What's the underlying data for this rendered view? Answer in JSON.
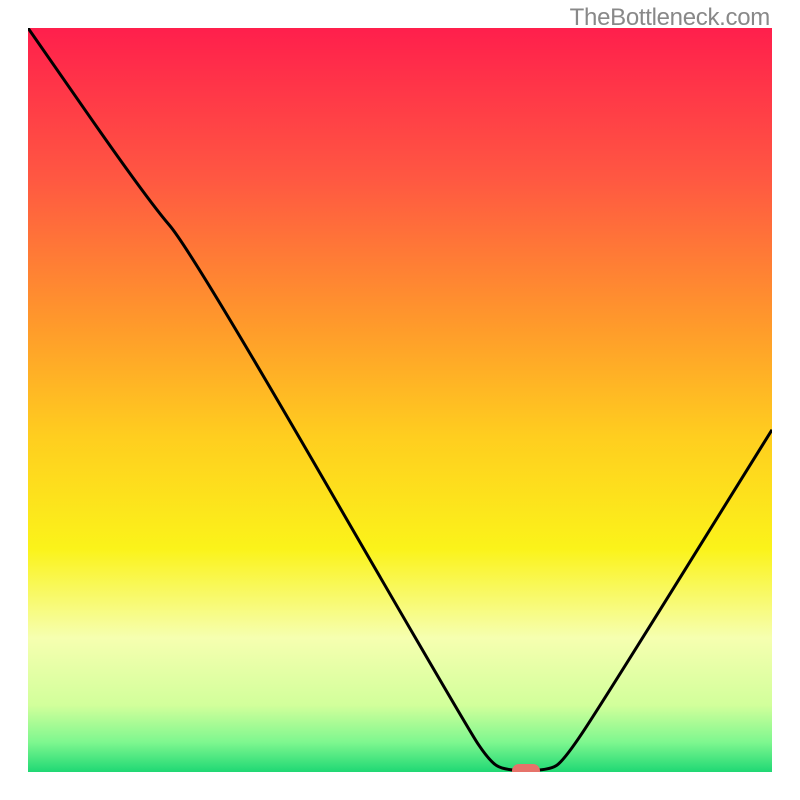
{
  "watermark": "TheBottleneck.com",
  "chart_data": {
    "type": "line",
    "title": "",
    "xlabel": "",
    "ylabel": "",
    "xlim": [
      0,
      100
    ],
    "ylim": [
      0,
      100
    ],
    "gradient_stops": [
      {
        "offset": 0,
        "color": "#ff1f4c"
      },
      {
        "offset": 20,
        "color": "#ff5742"
      },
      {
        "offset": 40,
        "color": "#ff9a2b"
      },
      {
        "offset": 55,
        "color": "#ffce1f"
      },
      {
        "offset": 70,
        "color": "#fbf31a"
      },
      {
        "offset": 82,
        "color": "#f6ffb0"
      },
      {
        "offset": 91,
        "color": "#d2ff9b"
      },
      {
        "offset": 96,
        "color": "#7ef78f"
      },
      {
        "offset": 100,
        "color": "#1fd874"
      }
    ],
    "series": [
      {
        "name": "curve",
        "points": [
          {
            "x": 0,
            "y": 100
          },
          {
            "x": 16,
            "y": 77
          },
          {
            "x": 22,
            "y": 70
          },
          {
            "x": 59,
            "y": 6
          },
          {
            "x": 62,
            "y": 1.5
          },
          {
            "x": 64,
            "y": 0.2
          },
          {
            "x": 70,
            "y": 0.2
          },
          {
            "x": 72,
            "y": 1.5
          },
          {
            "x": 77,
            "y": 9
          },
          {
            "x": 100,
            "y": 46
          }
        ]
      }
    ],
    "marker": {
      "x": 67,
      "y": 0.2
    }
  }
}
